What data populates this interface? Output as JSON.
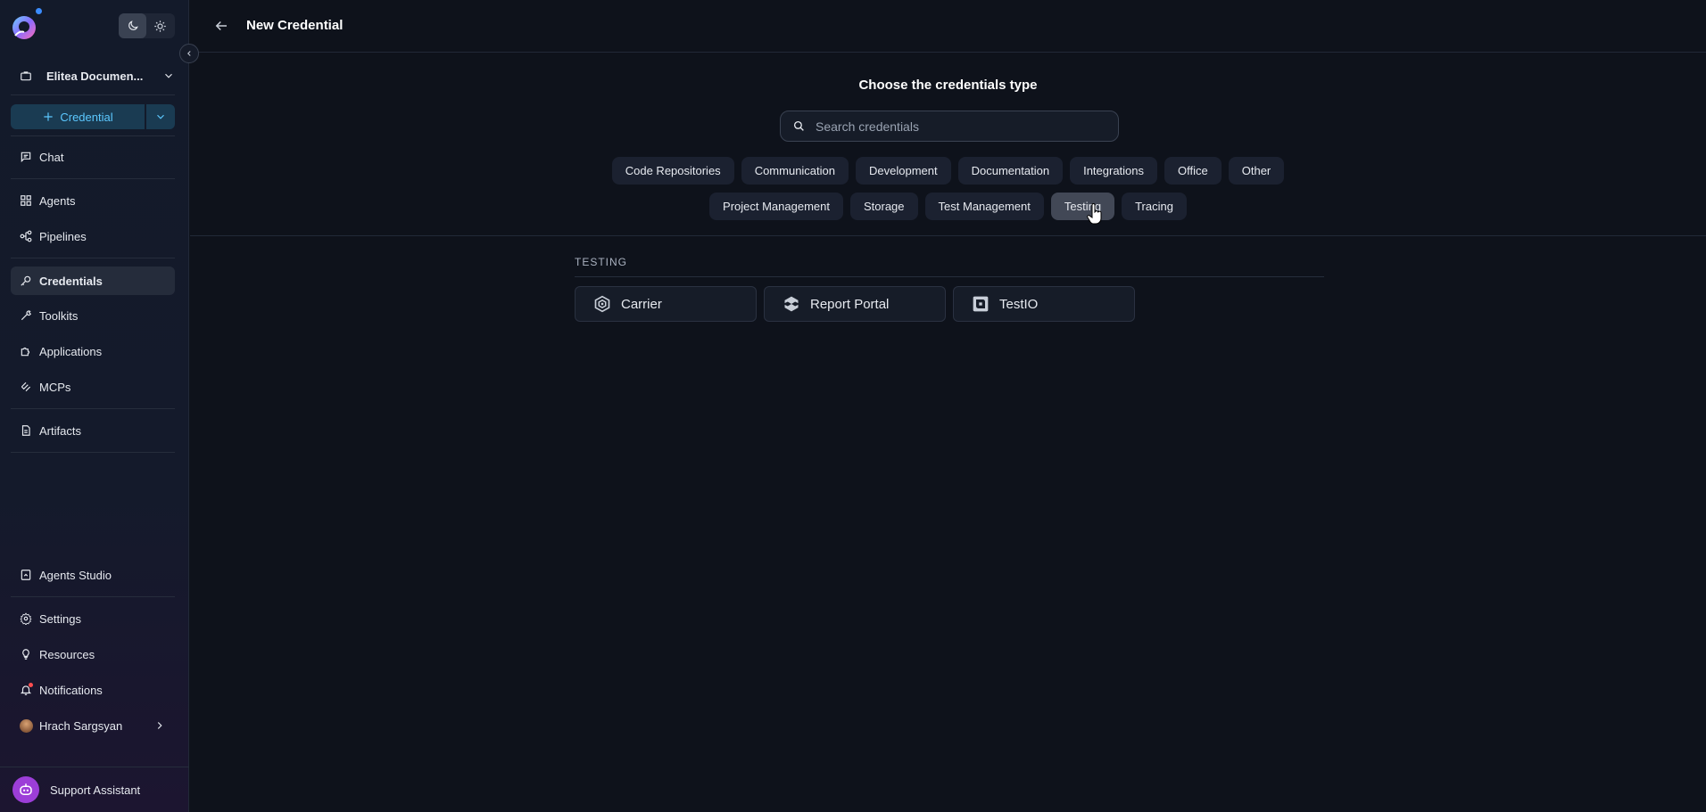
{
  "sidebar": {
    "project_name": "Elitea Documen...",
    "create_label": "Credential",
    "nav": [
      {
        "label": "Chat"
      },
      {
        "label": "Agents"
      },
      {
        "label": "Pipelines"
      },
      {
        "label": "Credentials"
      },
      {
        "label": "Toolkits"
      },
      {
        "label": "Applications"
      },
      {
        "label": "MCPs"
      },
      {
        "label": "Artifacts"
      }
    ],
    "bottom_nav": [
      {
        "label": "Agents Studio"
      },
      {
        "label": "Settings"
      },
      {
        "label": "Resources"
      },
      {
        "label": "Notifications"
      }
    ],
    "user_name": "Hrach Sargsyan",
    "support_label": "Support Assistant"
  },
  "header": {
    "title": "New Credential"
  },
  "main": {
    "choose_title": "Choose the credentials type",
    "search_placeholder": "Search credentials",
    "categories_row1": [
      "Code Repositories",
      "Communication",
      "Development",
      "Documentation",
      "Integrations",
      "Office",
      "Other"
    ],
    "categories_row2": [
      "Project Management",
      "Storage",
      "Test Management",
      "Testing",
      "Tracing"
    ],
    "active_category": "Testing",
    "section_label": "TESTING",
    "cards": [
      {
        "label": "Carrier",
        "icon": "carrier-icon"
      },
      {
        "label": "Report Portal",
        "icon": "report-portal-icon"
      },
      {
        "label": "TestIO",
        "icon": "testio-icon"
      }
    ]
  },
  "colors": {
    "background": "#0e121b",
    "accent": "#5cc8ff",
    "active_chip": "#424856"
  }
}
